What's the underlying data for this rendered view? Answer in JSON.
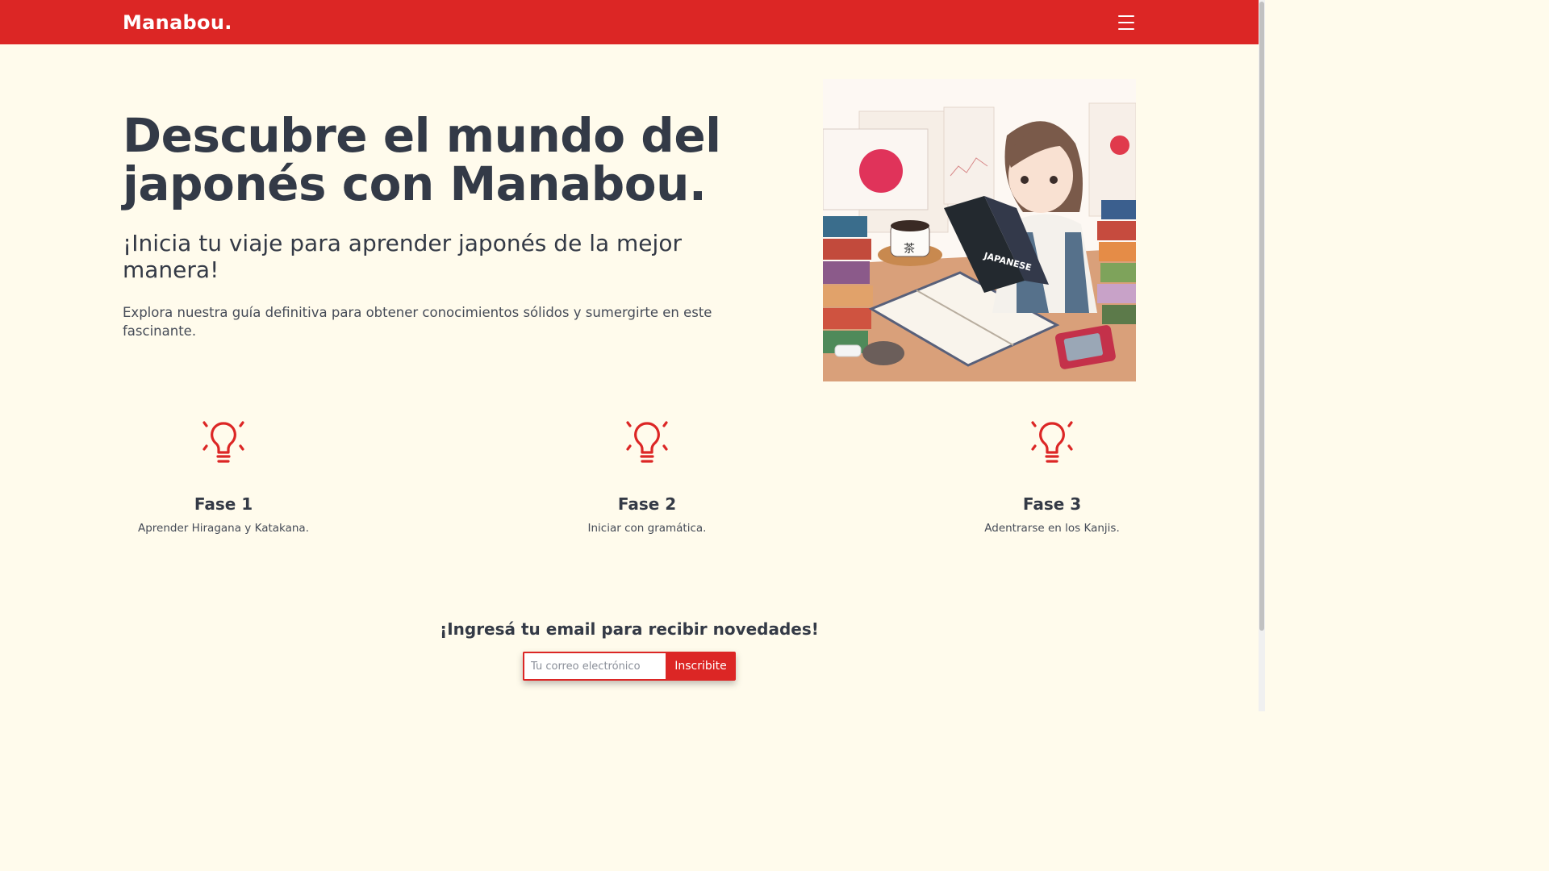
{
  "nav": {
    "brand": "Manabou.",
    "menu_icon": "hamburger-menu-icon"
  },
  "hero": {
    "title": "Descubre el mundo del japonés con Manabou.",
    "subtitle": "¡Inicia tu viaje para aprender japonés de la mejor manera!",
    "description": "Explora nuestra guía definitiva para obtener conocimientos sólidos y sumergirte en este fascinante.",
    "book_cover_text": "JAPANESE"
  },
  "phases": [
    {
      "icon": "lightbulb-icon",
      "title": "Fase 1",
      "description": "Aprender Hiragana y Katakana."
    },
    {
      "icon": "lightbulb-icon",
      "title": "Fase 2",
      "description": "Iniciar con gramática."
    },
    {
      "icon": "lightbulb-icon",
      "title": "Fase 3",
      "description": "Adentrarse en los Kanjis."
    }
  ],
  "newsletter": {
    "title": "¡Ingresá tu email para recibir novedades!",
    "placeholder": "Tu correo electrónico",
    "button_label": "Inscribite"
  },
  "colors": {
    "primary": "#dc2625",
    "background": "#fffbec",
    "text": "#343a46"
  }
}
